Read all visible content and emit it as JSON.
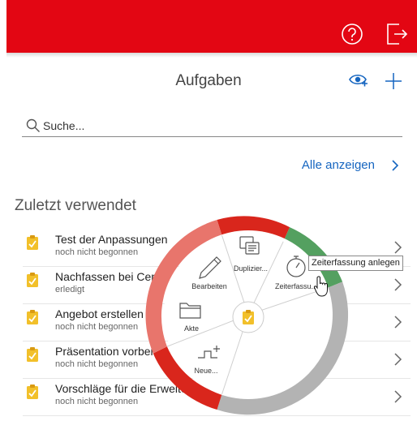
{
  "header": {
    "title": "Aufgaben"
  },
  "search": {
    "placeholder": "Suche..."
  },
  "show_all": "Alle anzeigen",
  "section_title": "Zuletzt verwendet",
  "tasks": [
    {
      "name": "Test der Anpassungen",
      "status": "noch nicht begonnen"
    },
    {
      "name": "Nachfassen bei Cent",
      "status": "erledigt"
    },
    {
      "name": "Angebot erstellen",
      "status": "noch nicht begonnen"
    },
    {
      "name": "Präsentation vorber",
      "status": "noch nicht begonnen"
    },
    {
      "name": "Vorschläge für die Erweite",
      "status": "noch nicht begonnen"
    }
  ],
  "wheel": {
    "items": [
      {
        "label": "Duplizier...",
        "icon": "duplicate-icon"
      },
      {
        "label": "Zeiterfassu...",
        "icon": "stopwatch-icon"
      },
      {
        "label": "Neue...",
        "icon": "new-item-icon"
      },
      {
        "label": "Akte",
        "icon": "folder-icon"
      },
      {
        "label": "Bearbeiten",
        "icon": "pencil-icon"
      }
    ],
    "center_icon": "task-clipboard-icon"
  },
  "tooltip": "Zeiterfassung anlegen",
  "colors": {
    "brand_red": "#e30613",
    "link_blue": "#1565c0",
    "ring_red": "#d9261c",
    "ring_salmon": "#e8756c",
    "ring_green": "#54a060",
    "ring_gray": "#b3b3b3",
    "task_icon_yellow": "#f2c02a"
  }
}
